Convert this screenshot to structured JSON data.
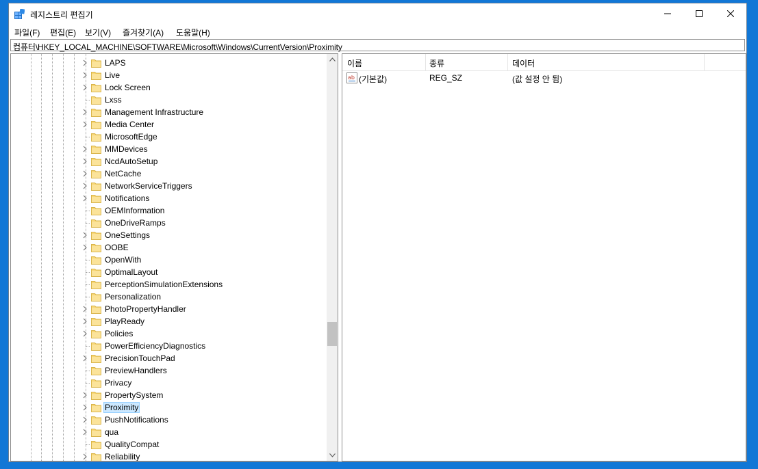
{
  "window": {
    "title": "레지스트리 편집기"
  },
  "menu": [
    "파일(F)",
    "편집(E)",
    "보기(V)",
    "즐겨찾기(A)",
    "도움말(H)"
  ],
  "address": "컴퓨터\\HKEY_LOCAL_MACHINE\\SOFTWARE\\Microsoft\\Windows\\CurrentVersion\\Proximity",
  "tree": {
    "items": [
      {
        "label": "LAPS",
        "expandable": true
      },
      {
        "label": "Live",
        "expandable": true
      },
      {
        "label": "Lock Screen",
        "expandable": true
      },
      {
        "label": "Lxss",
        "expandable": false
      },
      {
        "label": "Management Infrastructure",
        "expandable": true
      },
      {
        "label": "Media Center",
        "expandable": true
      },
      {
        "label": "MicrosoftEdge",
        "expandable": false
      },
      {
        "label": "MMDevices",
        "expandable": true
      },
      {
        "label": "NcdAutoSetup",
        "expandable": true
      },
      {
        "label": "NetCache",
        "expandable": true
      },
      {
        "label": "NetworkServiceTriggers",
        "expandable": true
      },
      {
        "label": "Notifications",
        "expandable": true
      },
      {
        "label": "OEMInformation",
        "expandable": false
      },
      {
        "label": "OneDriveRamps",
        "expandable": false
      },
      {
        "label": "OneSettings",
        "expandable": true
      },
      {
        "label": "OOBE",
        "expandable": true
      },
      {
        "label": "OpenWith",
        "expandable": false
      },
      {
        "label": "OptimalLayout",
        "expandable": false
      },
      {
        "label": "PerceptionSimulationExtensions",
        "expandable": false
      },
      {
        "label": "Personalization",
        "expandable": false
      },
      {
        "label": "PhotoPropertyHandler",
        "expandable": true
      },
      {
        "label": "PlayReady",
        "expandable": true
      },
      {
        "label": "Policies",
        "expandable": true
      },
      {
        "label": "PowerEfficiencyDiagnostics",
        "expandable": false
      },
      {
        "label": "PrecisionTouchPad",
        "expandable": true
      },
      {
        "label": "PreviewHandlers",
        "expandable": false
      },
      {
        "label": "Privacy",
        "expandable": false
      },
      {
        "label": "PropertySystem",
        "expandable": true
      },
      {
        "label": "Proximity",
        "expandable": true,
        "selected": true
      },
      {
        "label": "PushNotifications",
        "expandable": true
      },
      {
        "label": "qua",
        "expandable": true
      },
      {
        "label": "QualityCompat",
        "expandable": false
      },
      {
        "label": "Reliability",
        "expandable": true
      }
    ]
  },
  "list": {
    "columns": [
      "이름",
      "종류",
      "데이터"
    ],
    "rows": [
      {
        "name": "(기본값)",
        "type": "REG_SZ",
        "data": "(값 설정 안 됨)",
        "icon": "string-value-icon"
      }
    ]
  },
  "colors": {
    "desktop": "#1177d6",
    "folder": "#f8d775",
    "selection": "#cce8ff"
  }
}
